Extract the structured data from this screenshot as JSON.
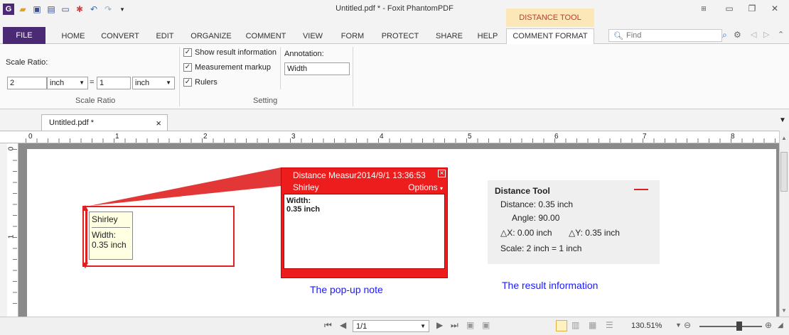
{
  "window": {
    "title": "Untitled.pdf * - Foxit PhantomPDF",
    "context_tab": "DISTANCE TOOL",
    "app_logo": "G"
  },
  "ribbon": {
    "tabs": [
      "FILE",
      "HOME",
      "CONVERT",
      "EDIT",
      "ORGANIZE",
      "COMMENT",
      "VIEW",
      "FORM",
      "PROTECT",
      "SHARE",
      "HELP",
      "COMMENT FORMAT"
    ],
    "find_placeholder": "Find",
    "scale_ratio": {
      "label": "Scale Ratio:",
      "left_value": "2",
      "left_unit": "inch",
      "equals": "=",
      "right_value": "1",
      "right_unit": "inch",
      "group_label": "Scale Ratio"
    },
    "setting": {
      "show_result": "Show result information",
      "markup": "Measurement markup",
      "rulers": "Rulers",
      "annotation_label": "Annotation:",
      "annotation_value": "Width",
      "group_label": "Setting"
    }
  },
  "doc_tab": {
    "label": "Untitled.pdf *",
    "close": "×"
  },
  "ruler": {
    "h_marks": [
      "0",
      "1",
      "2",
      "3",
      "4",
      "5",
      "6",
      "7",
      "8"
    ],
    "v_marks": [
      "0",
      "1"
    ]
  },
  "page": {
    "tooltip": {
      "author": "Shirley",
      "label": "Width:",
      "value": "0.35 inch"
    },
    "popup": {
      "title": "Distance Measur2014/9/1 13:36:53",
      "author": "Shirley",
      "options": "Options",
      "label": "Width:",
      "value": "0.35 inch",
      "close": "×"
    },
    "result": {
      "title": "Distance Tool",
      "distance": "Distance:  0.35 inch",
      "angle": "Angle:  90.00",
      "dx": "△X: 0.00 inch",
      "dy": "△Y: 0.35 inch",
      "scale": "Scale:  2 inch = 1 inch"
    },
    "captions": {
      "popup": "The pop-up note",
      "result": "The result information"
    }
  },
  "status": {
    "page": "1/1",
    "zoom": "130.51%"
  }
}
